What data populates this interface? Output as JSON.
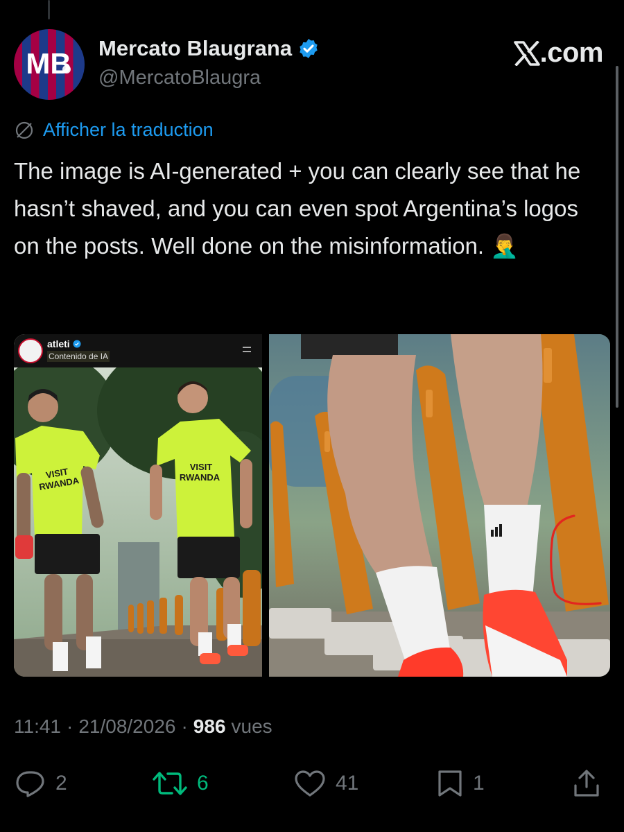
{
  "tweet": {
    "display_name": "Mercato Blaugrana",
    "handle": "@MercatoBlaugra",
    "avatar_text": "MB",
    "site_logo": ".com",
    "translate_label": "Afficher la traduction",
    "text": "The image is AI-generated + you can clearly see that he hasn’t shaved, and you can even spot Argentina’s logos on the posts. Well done on the misinformation. 🤦‍♂️",
    "time": "11:41",
    "date": "21/08/2026",
    "views_count": "986",
    "views_label": "vues",
    "separator": "·"
  },
  "media": {
    "embedded_post": {
      "account": "atleti",
      "sub_label": "Contenido de IA",
      "shirt_text_line1": "VISIT",
      "shirt_text_line2": "RWANDA"
    }
  },
  "actions": {
    "replies": "2",
    "retweets": "6",
    "likes": "41",
    "bookmarks": "1"
  },
  "colors": {
    "background": "#000000",
    "link_blue": "#1d9bf0",
    "retweet_green": "#00ba7c",
    "muted": "#71767b",
    "text": "#e7e9ea"
  },
  "icons": [
    "verified-badge-icon",
    "x-logo-icon",
    "translate-globe-icon",
    "reply-icon",
    "retweet-icon",
    "like-icon",
    "bookmark-icon",
    "share-icon"
  ]
}
